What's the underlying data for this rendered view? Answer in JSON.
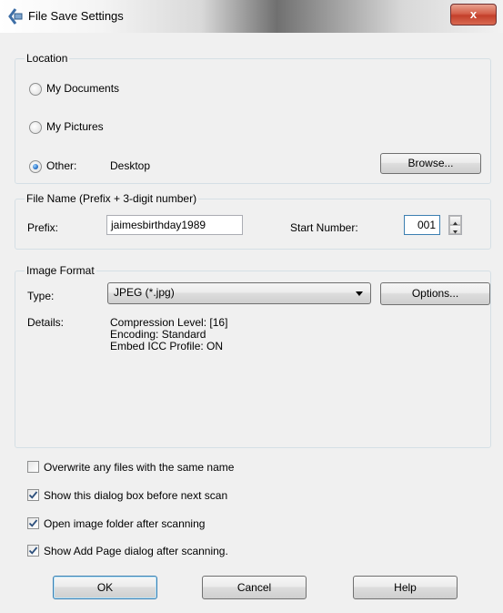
{
  "window": {
    "title": "File Save Settings",
    "close_glyph": "x",
    "icon": "scanner-icon"
  },
  "location": {
    "title": "Location",
    "options": [
      {
        "label": "My Documents",
        "selected": false
      },
      {
        "label": "My Pictures",
        "selected": false
      },
      {
        "label": "Other:",
        "selected": true
      }
    ],
    "other_value": "Desktop",
    "browse_label": "Browse..."
  },
  "file_name": {
    "title": "File Name (Prefix + 3-digit number)",
    "prefix_label": "Prefix:",
    "prefix_value": "jaimesbirthday1989",
    "start_number_label": "Start Number:",
    "start_number_value": "001"
  },
  "image_format": {
    "title": "Image Format",
    "type_label": "Type:",
    "type_value": "JPEG (*.jpg)",
    "options_label": "Options...",
    "details_label": "Details:",
    "details_lines": [
      "Compression Level: [16]",
      "Encoding: Standard",
      "Embed ICC Profile: ON"
    ]
  },
  "checkboxes": [
    {
      "label": "Overwrite any files with the same name",
      "checked": false
    },
    {
      "label": "Show this dialog box before next scan",
      "checked": true
    },
    {
      "label": "Open image folder after scanning",
      "checked": true
    },
    {
      "label": "Show Add Page dialog after scanning.",
      "checked": true
    }
  ],
  "buttons": {
    "ok": "OK",
    "cancel": "Cancel",
    "help": "Help"
  },
  "colors": {
    "accent": "#3c7fb1",
    "close_button": "#c33f2a"
  }
}
